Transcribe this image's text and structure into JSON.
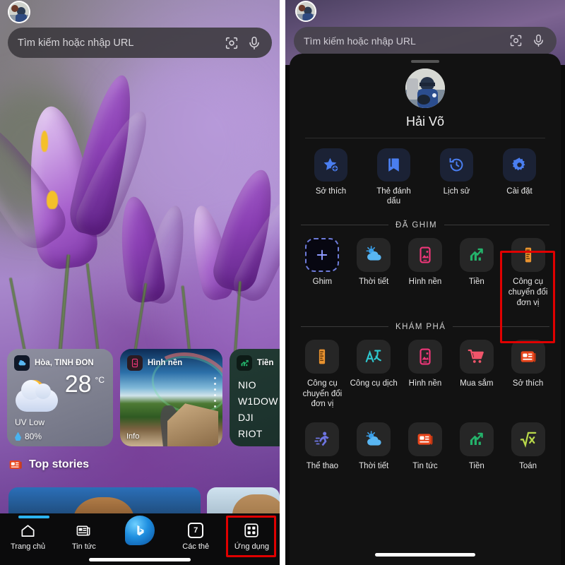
{
  "left_panel": {
    "search": {
      "placeholder": "Tìm kiếm hoặc nhập URL",
      "lens_icon": "lens-icon",
      "mic_icon": "microphone-icon"
    },
    "avatar_icon": "user-avatar",
    "widgets": [
      {
        "name": "weather",
        "icon": "weather-partly-cloudy-icon",
        "title": "Hòa, TỈNH ĐỒN",
        "temperature": "28",
        "unit": "°C",
        "uv": "UV Low",
        "humidity": "80%",
        "humidity_icon": "water-drop-icon"
      },
      {
        "name": "wallpaper",
        "icon": "wallpaper-phone-icon",
        "title": "Hình nền",
        "info_label": "Info"
      },
      {
        "name": "money",
        "icon": "stocks-trend-icon",
        "title": "Tiền",
        "tickers": [
          "NIO",
          "W1DOW",
          "DJI",
          "RIOT"
        ]
      }
    ],
    "top_stories": {
      "icon": "news-icon",
      "title": "Top stories"
    },
    "nav": [
      {
        "label": "Trang chủ",
        "icon": "home-icon",
        "highlighted": false
      },
      {
        "label": "Tin tức",
        "icon": "news-icon",
        "highlighted": false
      },
      {
        "label": "",
        "icon": "bing-chat-icon",
        "highlighted": false
      },
      {
        "label": "Các thẻ",
        "icon": "tab-count-icon",
        "badge": "7",
        "highlighted": false
      },
      {
        "label": "Ứng dụng",
        "icon": "apps-grid-icon",
        "highlighted": true
      }
    ]
  },
  "right_panel": {
    "search": {
      "placeholder": "Tìm kiếm hoặc nhập URL",
      "lens_icon": "lens-icon",
      "mic_icon": "microphone-icon"
    },
    "avatar_icon": "user-avatar",
    "profile": {
      "name": "Hải Võ",
      "avatar_icon": "profile-photo"
    },
    "quick_actions": [
      {
        "label": "Sở thích",
        "icon": "star-add-icon"
      },
      {
        "label": "Thẻ đánh dấu",
        "icon": "bookmark-icon"
      },
      {
        "label": "Lịch sử",
        "icon": "history-clock-icon"
      },
      {
        "label": "Cài đặt",
        "icon": "gear-icon"
      }
    ],
    "pinned_section": {
      "caption": "ĐÃ GHIM"
    },
    "pinned": [
      {
        "label": "Ghim",
        "icon": "plus-add-icon",
        "highlighted": false
      },
      {
        "label": "Thời tiết",
        "icon": "weather-partly-cloudy-icon",
        "highlighted": false
      },
      {
        "label": "Hình nền",
        "icon": "wallpaper-phone-icon",
        "highlighted": false
      },
      {
        "label": "Tiền",
        "icon": "stocks-trend-icon",
        "highlighted": false
      },
      {
        "label": "Công cụ chuyển đổi đơn vị",
        "icon": "ruler-converter-icon",
        "highlighted": true
      }
    ],
    "explore_section": {
      "caption": "KHÁM PHÁ"
    },
    "explore_row1": [
      {
        "label": "Công cụ chuyển đổi đơn vị",
        "icon": "ruler-converter-icon"
      },
      {
        "label": "Công cụ dịch",
        "icon": "translate-icon"
      },
      {
        "label": "Hình nền",
        "icon": "wallpaper-phone-icon"
      },
      {
        "label": "Mua sắm",
        "icon": "shopping-cart-icon"
      },
      {
        "label": "Sở thích",
        "icon": "news-icon"
      }
    ],
    "explore_row2": [
      {
        "label": "Thể thao",
        "icon": "running-person-icon"
      },
      {
        "label": "Thời tiết",
        "icon": "weather-partly-cloudy-icon"
      },
      {
        "label": "Tin tức",
        "icon": "news-icon"
      },
      {
        "label": "Tiền",
        "icon": "stocks-trend-icon"
      },
      {
        "label": "Toán",
        "icon": "math-sqrt-icon"
      }
    ]
  },
  "colors": {
    "highlight_red": "#e00000",
    "accent_blue": "#2bb3ef",
    "tile_blue": "#1b2235",
    "icon_blue": "#4a7ef0",
    "orange": "#e8922f",
    "green": "#24b36b",
    "pink": "#f0377a",
    "teal": "#2ec7cf",
    "sheet_bg": "#121212"
  }
}
